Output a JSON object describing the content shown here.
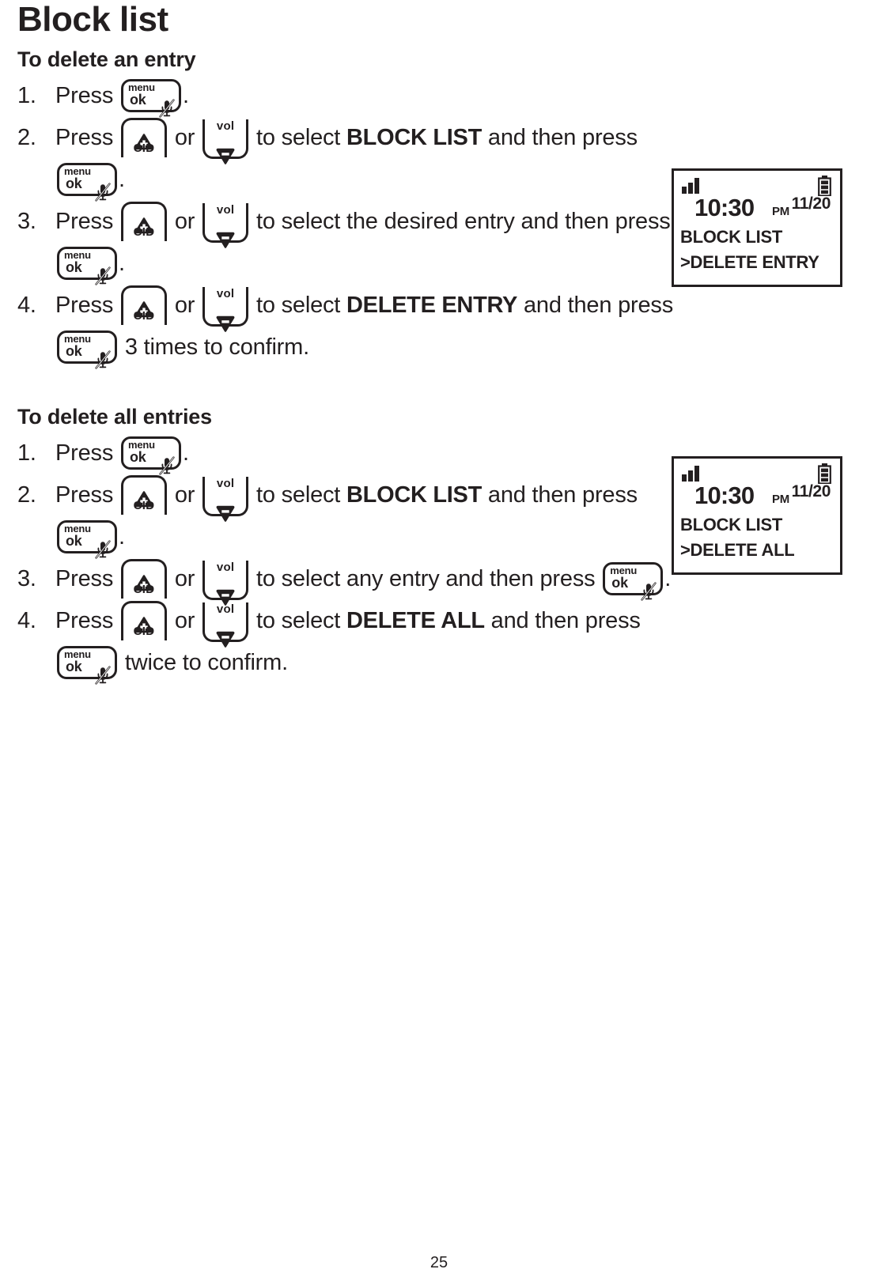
{
  "document": {
    "page_title": "Block list",
    "page_number": "25"
  },
  "keys": {
    "menu_ok": {
      "top_label": "menu",
      "bottom_label": "ok",
      "icon": "mic-muted-icon"
    },
    "cid_up": {
      "label": "CID",
      "icon": "triangle-up-plus-icon"
    },
    "vol_down": {
      "label": "vol",
      "icon": "triangle-down-minus-icon"
    }
  },
  "sections": [
    {
      "id": "delete-an-entry",
      "heading": "To delete an entry",
      "steps": [
        {
          "number": "1.",
          "parts": [
            {
              "type": "text",
              "value": "Press "
            },
            {
              "type": "key",
              "value": "menu_ok"
            },
            {
              "type": "text",
              "value": "."
            }
          ]
        },
        {
          "number": "2.",
          "parts": [
            {
              "type": "text",
              "value": "Press "
            },
            {
              "type": "key",
              "value": "cid_up"
            },
            {
              "type": "text",
              "value": " or "
            },
            {
              "type": "key",
              "value": "vol_down"
            },
            {
              "type": "text",
              "value": " to select "
            },
            {
              "type": "strong",
              "value": "BLOCK LIST"
            },
            {
              "type": "text",
              "value": " and then press "
            },
            {
              "type": "key",
              "value": "menu_ok"
            },
            {
              "type": "text",
              "value": "."
            }
          ]
        },
        {
          "number": "3.",
          "parts": [
            {
              "type": "text",
              "value": "Press "
            },
            {
              "type": "key",
              "value": "cid_up"
            },
            {
              "type": "text",
              "value": " or "
            },
            {
              "type": "key",
              "value": "vol_down"
            },
            {
              "type": "text",
              "value": " to select the desired entry and then press "
            },
            {
              "type": "key",
              "value": "menu_ok"
            },
            {
              "type": "text",
              "value": "."
            }
          ]
        },
        {
          "number": "4.",
          "parts": [
            {
              "type": "text",
              "value": "Press "
            },
            {
              "type": "key",
              "value": "cid_up"
            },
            {
              "type": "text",
              "value": " or "
            },
            {
              "type": "key",
              "value": "vol_down"
            },
            {
              "type": "text",
              "value": " to select "
            },
            {
              "type": "strong",
              "value": "DELETE ENTRY"
            },
            {
              "type": "text",
              "value": " and then press "
            },
            {
              "type": "key",
              "value": "menu_ok"
            },
            {
              "type": "text",
              "value": " 3 times to confirm."
            }
          ]
        }
      ]
    },
    {
      "id": "delete-all-entries",
      "heading": "To delete all entries",
      "steps": [
        {
          "number": "1.",
          "parts": [
            {
              "type": "text",
              "value": "Press "
            },
            {
              "type": "key",
              "value": "menu_ok"
            },
            {
              "type": "text",
              "value": "."
            }
          ]
        },
        {
          "number": "2.",
          "parts": [
            {
              "type": "text",
              "value": "Press "
            },
            {
              "type": "key",
              "value": "cid_up"
            },
            {
              "type": "text",
              "value": " or "
            },
            {
              "type": "key",
              "value": "vol_down"
            },
            {
              "type": "text",
              "value": " to select "
            },
            {
              "type": "strong",
              "value": "BLOCK LIST"
            },
            {
              "type": "text",
              "value": " and then press "
            },
            {
              "type": "key",
              "value": "menu_ok"
            },
            {
              "type": "text",
              "value": "."
            }
          ]
        },
        {
          "number": "3.",
          "parts": [
            {
              "type": "text",
              "value": "Press "
            },
            {
              "type": "key",
              "value": "cid_up"
            },
            {
              "type": "text",
              "value": " or "
            },
            {
              "type": "key",
              "value": "vol_down"
            },
            {
              "type": "text",
              "value": " to select any entry and then press "
            },
            {
              "type": "key",
              "value": "menu_ok"
            },
            {
              "type": "text",
              "value": "."
            }
          ]
        },
        {
          "number": "4.",
          "parts": [
            {
              "type": "text",
              "value": "Press "
            },
            {
              "type": "key",
              "value": "cid_up"
            },
            {
              "type": "text",
              "value": " or "
            },
            {
              "type": "key",
              "value": "vol_down"
            },
            {
              "type": "text",
              "value": " to select "
            },
            {
              "type": "strong",
              "value": "DELETE ALL"
            },
            {
              "type": "text",
              "value": " and then press "
            },
            {
              "type": "key",
              "value": "menu_ok"
            },
            {
              "type": "text",
              "value": " twice to confirm."
            }
          ]
        }
      ]
    }
  ],
  "lcd_screens": [
    {
      "id": "lcd-delete-entry",
      "signal_icon": "signal-bars-icon",
      "battery_icon": "battery-full-icon",
      "time": "10:30",
      "ampm": "PM",
      "date": "11/20",
      "line1": "BLOCK LIST",
      "line2": ">DELETE ENTRY"
    },
    {
      "id": "lcd-delete-all",
      "signal_icon": "signal-bars-icon",
      "battery_icon": "battery-full-icon",
      "time": "10:30",
      "ampm": "PM",
      "date": "11/20",
      "line1": "BLOCK LIST",
      "line2": ">DELETE ALL"
    }
  ]
}
